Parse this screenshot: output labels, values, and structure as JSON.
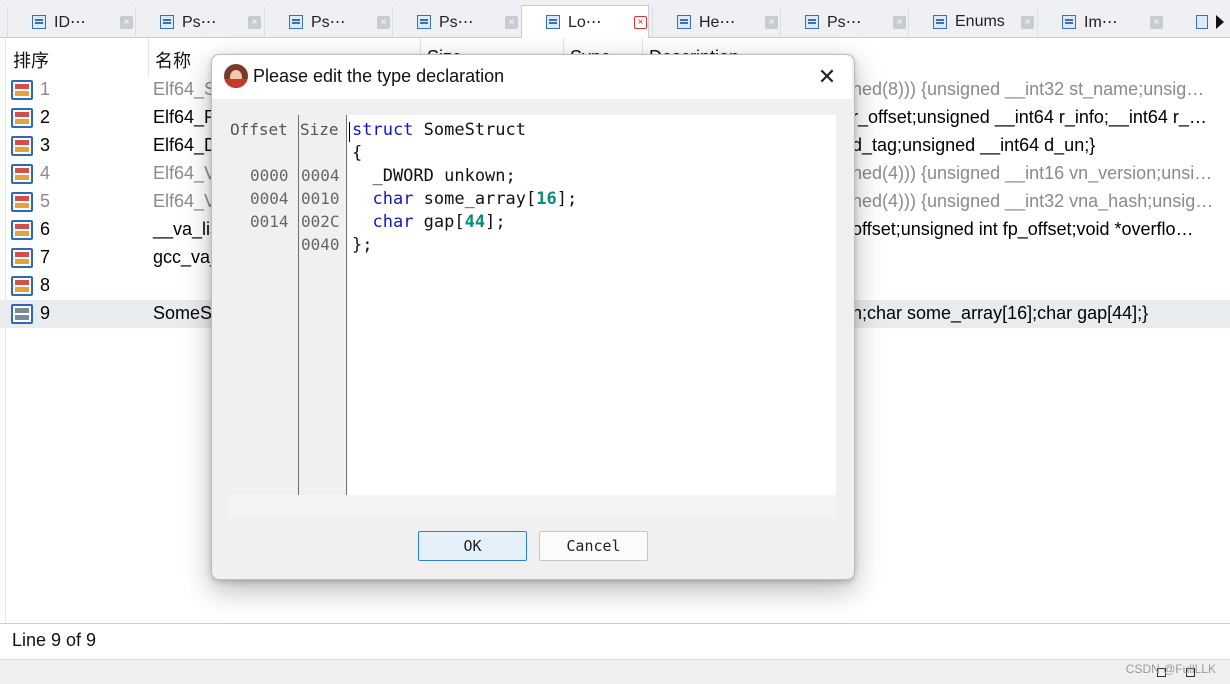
{
  "tabs": [
    {
      "label": "ID⋯",
      "icon": "structures-icon",
      "active": false
    },
    {
      "label": "Ps⋯",
      "icon": "pseudocode-icon",
      "active": false
    },
    {
      "label": "Ps⋯",
      "icon": "pseudocode-icon",
      "active": false
    },
    {
      "label": "Ps⋯",
      "icon": "pseudocode-icon",
      "active": false
    },
    {
      "label": "Lo⋯",
      "icon": "local-types-icon",
      "active": true
    },
    {
      "label": "He⋯",
      "icon": "hex-view-icon",
      "active": false
    },
    {
      "label": "Ps⋯",
      "icon": "pseudocode-icon",
      "active": false
    },
    {
      "label": "Enums",
      "icon": "enums-icon",
      "active": false
    },
    {
      "label": "Im⋯",
      "icon": "imports-icon",
      "active": false
    }
  ],
  "table": {
    "columns": {
      "ordinal": "排序",
      "name": "名称",
      "size": "Size",
      "sync": "Sync",
      "description": "Description"
    },
    "rows": [
      {
        "num": "1",
        "name": "Elf64_S",
        "desc": "ned(8))) {unsigned __int32 st_name;unsig…",
        "grey": true
      },
      {
        "num": "2",
        "name": "Elf64_R",
        "desc": "r_offset;unsigned __int64 r_info;__int64 r_…",
        "grey": false
      },
      {
        "num": "3",
        "name": "Elf64_D",
        "desc": "d_tag;unsigned __int64 d_un;}",
        "grey": false
      },
      {
        "num": "4",
        "name": "Elf64_V",
        "desc": "ned(4))) {unsigned __int16 vn_version;unsi…",
        "grey": true
      },
      {
        "num": "5",
        "name": "Elf64_V",
        "desc": "ned(4))) {unsigned __int32 vna_hash;unsig…",
        "grey": true
      },
      {
        "num": "6",
        "name": "__va_lis",
        "desc": "offset;unsigned int fp_offset;void *overflo…",
        "grey": false
      },
      {
        "num": "7",
        "name": "gcc_va_",
        "desc": "",
        "grey": false
      },
      {
        "num": "8",
        "name": "",
        "desc": "",
        "grey": false
      },
      {
        "num": "9",
        "name": "SomeS",
        "desc": "n;char some_array[16];char gap[44];}",
        "grey": false,
        "selected": true
      }
    ]
  },
  "status": {
    "line_info": "Line 9 of 9"
  },
  "watermark": "CSDN @FullLLK",
  "dialog": {
    "title": "Please edit the type declaration",
    "close": "✕",
    "gutter_headers": {
      "offset": "Offset",
      "size": "Size"
    },
    "gutter_rows": [
      {
        "offset": "",
        "size": ""
      },
      {
        "offset": "",
        "size": ""
      },
      {
        "offset": "0000",
        "size": "0004"
      },
      {
        "offset": "0004",
        "size": "0010"
      },
      {
        "offset": "0014",
        "size": "002C"
      },
      {
        "offset": "",
        "size": "0040"
      }
    ],
    "code": [
      {
        "parts": [
          {
            "t": "struct",
            "c": "kw"
          },
          {
            "t": " SomeStruct",
            "c": ""
          }
        ]
      },
      {
        "parts": [
          {
            "t": "{",
            "c": ""
          }
        ]
      },
      {
        "parts": [
          {
            "t": "  _DWORD unkown;",
            "c": ""
          }
        ]
      },
      {
        "parts": [
          {
            "t": "  ",
            "c": ""
          },
          {
            "t": "char",
            "c": "kw"
          },
          {
            "t": " some_array[",
            "c": ""
          },
          {
            "t": "16",
            "c": "num"
          },
          {
            "t": "];",
            "c": ""
          }
        ]
      },
      {
        "parts": [
          {
            "t": "  ",
            "c": ""
          },
          {
            "t": "char",
            "c": "kw"
          },
          {
            "t": " gap[",
            "c": ""
          },
          {
            "t": "44",
            "c": "num"
          },
          {
            "t": "];",
            "c": ""
          }
        ]
      },
      {
        "parts": [
          {
            "t": "};",
            "c": ""
          }
        ]
      }
    ],
    "ok_label": "OK",
    "cancel_label": "Cancel"
  }
}
